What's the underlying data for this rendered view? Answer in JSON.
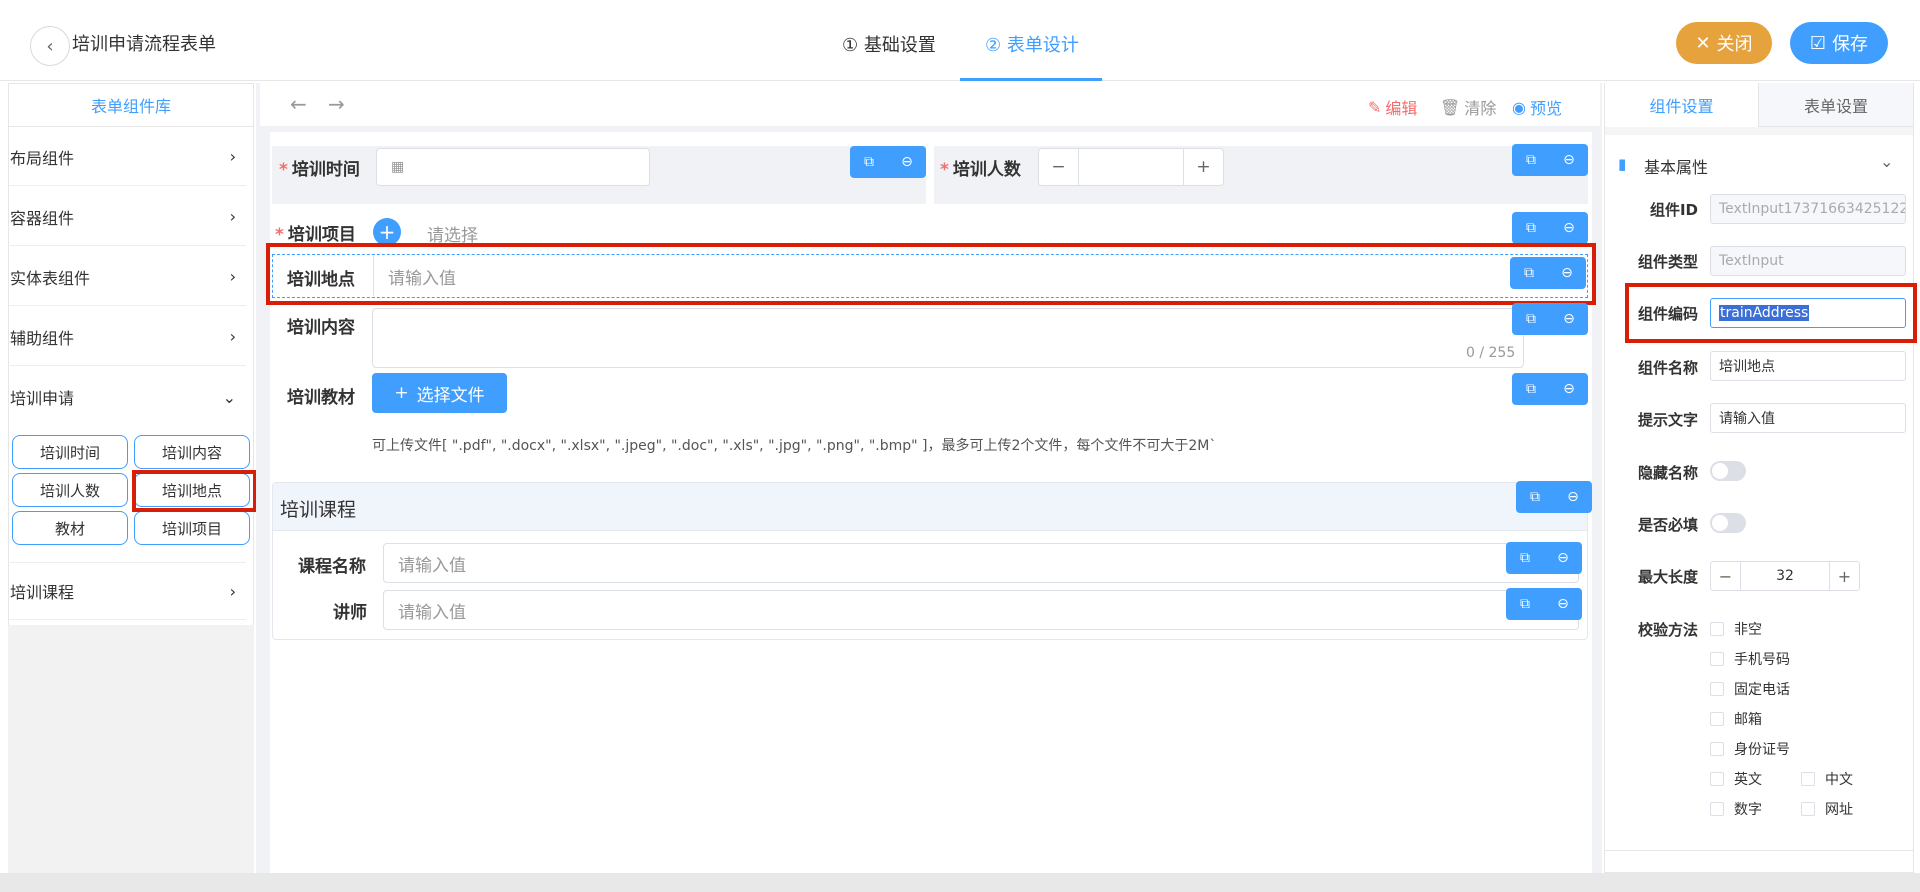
{
  "header": {
    "back_icon": "chevron-left-icon",
    "title": "培训申请流程表单",
    "step1": "① 基础设置",
    "step2": "② 表单设计",
    "close_label": "关闭",
    "save_label": "保存",
    "colors": {
      "accent": "#409eff",
      "close": "#e6a23c"
    }
  },
  "left": {
    "title": "表单组件库",
    "categories": [
      "布局组件",
      "容器组件",
      "实体表组件",
      "辅助组件",
      "培训申请",
      "培训课程"
    ],
    "chips": [
      "培训时间",
      "培训内容",
      "培训人数",
      "培训地点",
      "教材",
      "培训项目"
    ]
  },
  "toolbar": {
    "edit": "编辑",
    "clear": "清除",
    "preview": "预览"
  },
  "form": {
    "time_label": "培训时间",
    "count_label": "培训人数",
    "project_label": "培训项目",
    "project_placeholder": "请选择",
    "address_label": "培训地点",
    "address_placeholder": "请输入值",
    "content_label": "培训内容",
    "content_counter": "0 / 255",
    "material_label": "培训教材",
    "upload_button": "选择文件",
    "upload_hint": "可上传文件[ \".pdf\", \".docx\", \".xlsx\", \".jpeg\", \".doc\", \".xls\", \".jpg\", \".png\", \".bmp\" ]，最多可上传2个文件，每个文件不可大于2M`",
    "course_section": "培训课程",
    "course_name_label": "课程名称",
    "course_name_placeholder": "请输入值",
    "teacher_label": "讲师",
    "teacher_placeholder": "请输入值"
  },
  "right": {
    "tab_component": "组件设置",
    "tab_form": "表单设置",
    "section_title": "基本属性",
    "id_label": "组件ID",
    "id_value": "TextInput17371663425122",
    "type_label": "组件类型",
    "type_value": "TextInput",
    "code_label": "组件编码",
    "code_value": "trainAddress",
    "name_label": "组件名称",
    "name_value": "培训地点",
    "hint_label": "提示文字",
    "hint_value": "请输入值",
    "hide_label": "隐藏名称",
    "required_label": "是否必填",
    "maxlen_label": "最大长度",
    "maxlen_value": "32",
    "validate_label": "校验方法",
    "validations": [
      "非空",
      "手机号码",
      "固定电话",
      "邮箱",
      "身份证号",
      "英文",
      "中文",
      "数字",
      "网址"
    ]
  }
}
